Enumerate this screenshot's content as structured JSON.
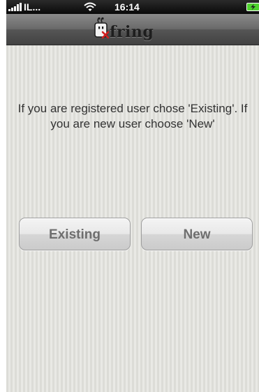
{
  "status_bar": {
    "carrier": "IL...",
    "time": "16:14",
    "icons": [
      "signal-bars-icon",
      "wifi-icon",
      "battery-charging-icon"
    ]
  },
  "nav_bar": {
    "logo_text": "fring"
  },
  "content": {
    "message": "If you are registered user chose 'Existing'. If you are new user choose 'New'"
  },
  "buttons": {
    "existing_label": "Existing",
    "new_label": "New"
  },
  "colors": {
    "status_bar_bg": "#0d0d0d",
    "nav_bar_bg": "#6a6a6a",
    "content_bg": "#e3e3df",
    "message_text": "#333333",
    "button_text": "#6e6e6e",
    "logo_accent": "#d21e1e",
    "battery_fill": "#4fd12f"
  }
}
